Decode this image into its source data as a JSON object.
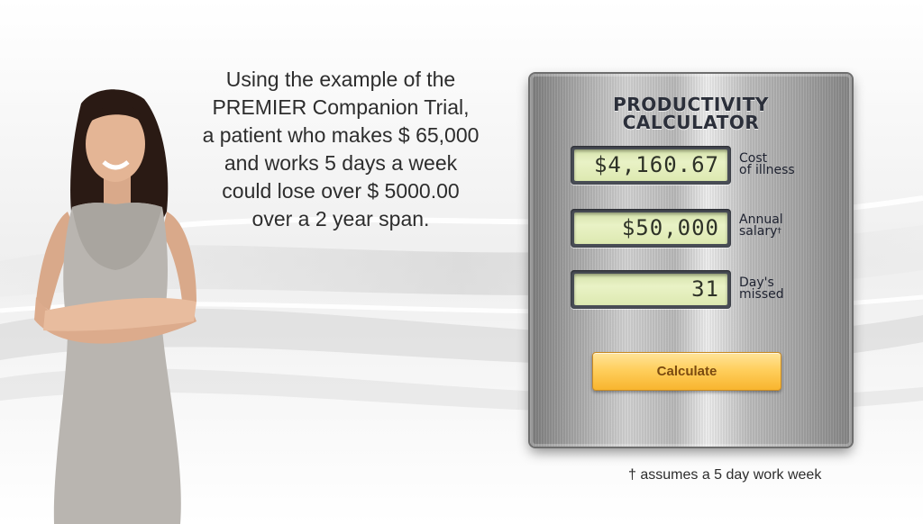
{
  "intro": {
    "lines": [
      "Using the example of the",
      "PREMIER Companion Trial,",
      "a patient who makes $ 65,000",
      "and works 5 days a week",
      "could lose over $ 5000.00",
      "over a 2 year span."
    ]
  },
  "calculator": {
    "title_line1": "PRODUCTIVITY",
    "title_line2": "CALCULATOR",
    "fields": [
      {
        "value": "$4,160.67",
        "label_line1": "Cost",
        "label_line2": "of illness"
      },
      {
        "value": "$50,000",
        "label_line1": "Annual",
        "label_line2": "salary",
        "label_mark": "†"
      },
      {
        "value": "31",
        "label_line1": "Day's",
        "label_line2": "missed"
      }
    ],
    "button_label": "Calculate"
  },
  "footnote": "† assumes a 5 day work week",
  "colors": {
    "button": "#ffcf5d",
    "lcd_screen": "#e2edb9",
    "title": "#2b2f3a"
  }
}
